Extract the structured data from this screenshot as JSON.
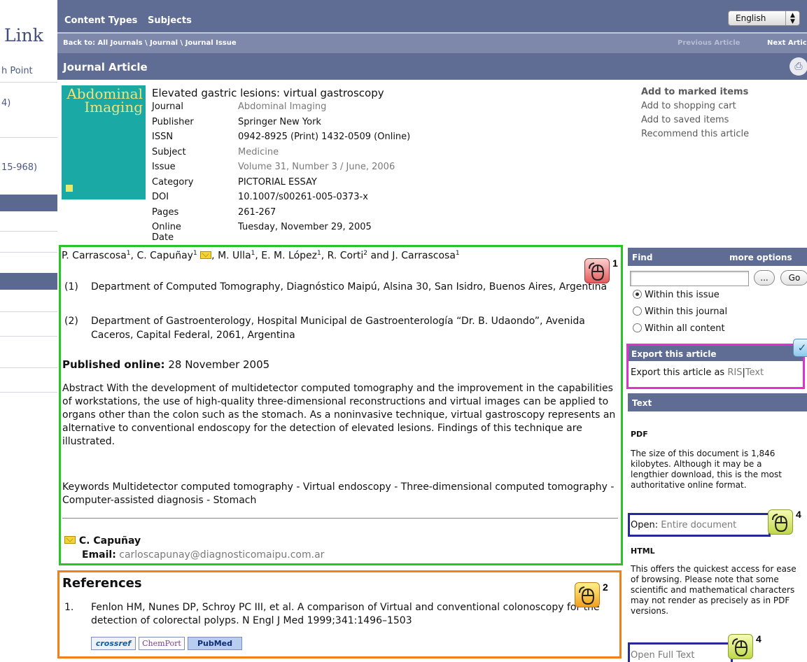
{
  "sidebar": {
    "logo": "Link",
    "texts": [
      "h Point",
      "4)",
      "15-968)"
    ]
  },
  "header": {
    "nav": [
      "Content Types",
      "Subjects"
    ],
    "language": "English",
    "breadcrumb": "Back to:  All Journals \\ Journal \\ Journal Issue",
    "previous": "Previous Article",
    "next": "Next Article",
    "page_title": "Journal Article"
  },
  "cover": {
    "title_line1": "Abdominal",
    "title_line2": "Imaging"
  },
  "article": {
    "title": "Elevated gastric lesions: virtual gastroscopy",
    "meta": [
      {
        "key": "Journal",
        "value": "Abdominal Imaging",
        "link": true
      },
      {
        "key": "Publisher",
        "value": "Springer New York",
        "link": false
      },
      {
        "key": "ISSN",
        "value": "0942-8925 (Print) 1432-0509 (Online)",
        "link": false
      },
      {
        "key": "Subject",
        "value": "Medicine",
        "link": true
      },
      {
        "key": "Issue",
        "value": "Volume 31, Number 3 / June, 2006",
        "link": true
      },
      {
        "key": "Category",
        "value": "PICTORIAL ESSAY",
        "link": false
      },
      {
        "key": "DOI",
        "value": "10.1007/s00261-005-0373-x",
        "link": false
      },
      {
        "key": "Pages",
        "value": "261-267",
        "link": false
      },
      {
        "key": "Online Date",
        "value": "Tuesday, November 29, 2005",
        "link": false
      }
    ],
    "actions": [
      "Add to marked items",
      "Add to shopping cart",
      "Add to saved items",
      "Recommend this article"
    ],
    "authors": [
      {
        "name": "P. Carrascosa",
        "sup": "1"
      },
      {
        "name": "C. Capuñay",
        "sup": "1"
      },
      {
        "name": "M. Ulla",
        "sup": "1"
      },
      {
        "name": "E. M. López",
        "sup": "1"
      },
      {
        "name": "R. Corti",
        "sup": "2"
      },
      {
        "name": "J. Carrascosa",
        "sup": "1"
      }
    ],
    "and_word": "and",
    "affiliations": [
      {
        "num": "(1)",
        "text": "Department of Computed Tomography, Diagnóstico Maipú, Alsina 30, San Isidro, Buenos Aires, Argentina"
      },
      {
        "num": "(2)",
        "text": "Department of Gastroenterology, Hospital Municipal de Gastroenterología “Dr. B. Udaondo”, Avenida Caceros, Capital Federal, 2061, Argentina"
      }
    ],
    "published_label": "Published online:",
    "published_date": "28 November 2005",
    "abstract": "Abstract  With the development of multidetector computed tomography and the improvement in the capabilities of workstations, the use of high-quality three-dimensional reconstructions and virtual images can be applied to organs other than the colon such as the stomach. As a noninvasive technique, virtual gastroscopy represents an alternative to conventional endoscopy for the detection of elevated lesions. Findings of this technique are illustrated.",
    "keywords": "Keywords  Multidetector computed tomography - Virtual endoscopy - Three-dimensional computed tomography - Computer-assisted diagnosis - Stomach",
    "correspondent": "C. Capuñay",
    "email_label": "Email:",
    "email": "carloscapunay@diagnosticomaipu.com.ar"
  },
  "references": {
    "heading": "References",
    "items": [
      {
        "num": "1.",
        "text": "Fenlon HM, Nunes DP, Schroy PC III, et al. A comparison of Virtual and conventional colonoscopy for the detection of colorectal polyps. N Engl J Med 1999;341:1496–1503"
      }
    ],
    "buttons": {
      "crossref": "crossref",
      "chemport": "ChemPort",
      "pubmed": "PubMed"
    }
  },
  "find": {
    "title": "Find",
    "more": "more options",
    "dots": "...",
    "go": "Go",
    "options": [
      "Within this issue",
      "Within this journal",
      "Within all content"
    ],
    "selected": 0
  },
  "export": {
    "title": "Export this article",
    "prefix": "Export this article as",
    "ris": "RIS",
    "sep": "|",
    "text": "Text"
  },
  "text_panel": {
    "title": "Text",
    "pdf_label": "PDF",
    "pdf_desc": "The size of this document is 1,846 kilobytes. Although it may be a lengthier download, this is the most authoritative online format.",
    "open_label": "Open:",
    "open_link": "Entire document",
    "html_label": "HTML",
    "html_desc": "This offers the quickest access for ease of browsing. Please note that some scientific and mathematical characters may not render as precisely as in PDF versions.",
    "open_full": "Open Full Text"
  },
  "badges": [
    "1",
    "2",
    "4",
    "4"
  ],
  "colors": {
    "header": "#5f6c93",
    "green_box": "#26c426",
    "orange_box": "#f08019",
    "pink_box": "#e52dd2",
    "blue_box": "#242a9b",
    "link_gray": "#7a7a7a"
  }
}
